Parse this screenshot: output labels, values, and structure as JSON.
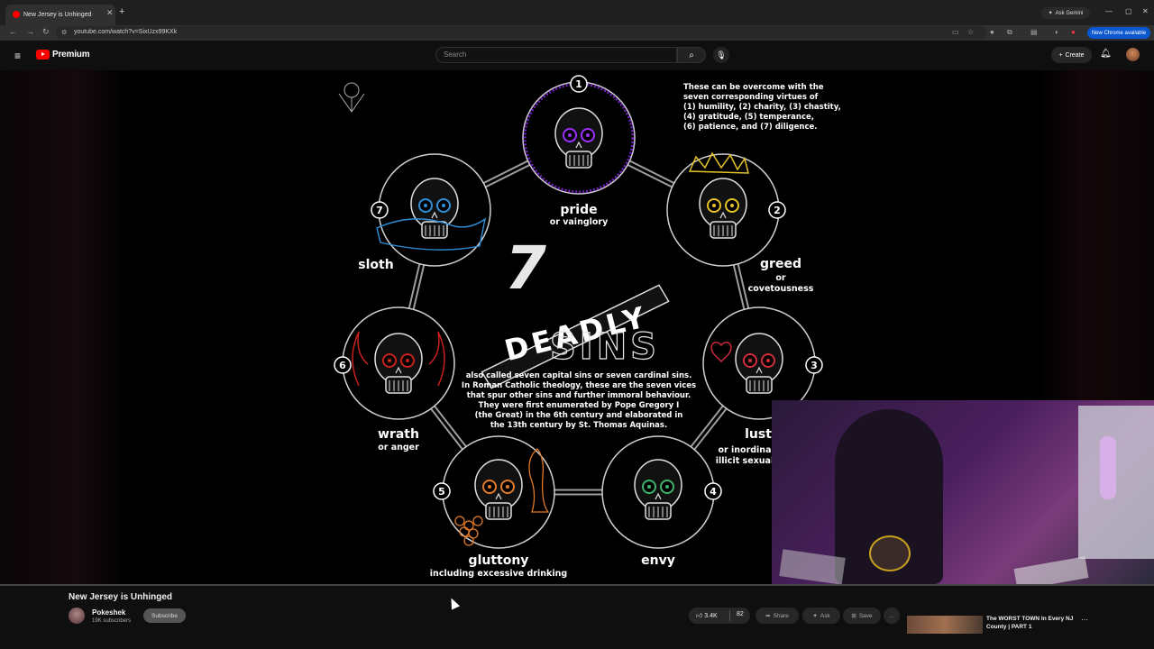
{
  "browser": {
    "tab_title": "New Jersey is Unhinged - YouTube",
    "new_tab_symbol": "+",
    "ask_gemini": "Ask Gemini",
    "url": "youtube.com/watch?v=SixUzx99KXk",
    "new_chrome": "New Chrome available"
  },
  "youtube": {
    "logo_text": "Premium",
    "search_placeholder": "Search",
    "create_label": "Create"
  },
  "video_art": {
    "number_seven": "7",
    "title_word_1": "DEADLY",
    "title_word_2": "SINS",
    "virtues": [
      "These can be overcome with the",
      "seven corresponding virtues of",
      "(1) humility, (2) charity, (3) chastity,",
      "(4) gratitude, (5) temperance,",
      "(6) patience, and (7) diligence."
    ],
    "description": [
      "also called seven capital sins or seven cardinal sins.",
      "In Roman Catholic theology, these are the seven vices",
      "that spur other sins and further immoral behaviour.",
      "They were first enumerated by Pope Gregory I",
      "(the Great) in the 6th century and elaborated in",
      "the 13th century by St. Thomas Aquinas."
    ],
    "sins": [
      {
        "num": "1",
        "name": "pride",
        "sub": "or vainglory",
        "color": "#9b30ff"
      },
      {
        "num": "2",
        "name": "greed",
        "sub1": "or",
        "sub2": "covetousness",
        "color": "#e6c229"
      },
      {
        "num": "3",
        "name": "lust",
        "sub1": "or inordina",
        "sub2": "illicit sexual",
        "color": "#d22c3c"
      },
      {
        "num": "4",
        "name": "envy",
        "sub": "",
        "color": "#3cb46e"
      },
      {
        "num": "5",
        "name": "gluttony",
        "sub": "including excessive drinking",
        "color": "#e07a2a"
      },
      {
        "num": "6",
        "name": "wrath",
        "sub": "or anger",
        "color": "#c8201e"
      },
      {
        "num": "7",
        "name": "sloth",
        "sub": "",
        "color": "#2e8fd8"
      }
    ]
  },
  "video": {
    "title": "New Jersey is Unhinged",
    "channel": "Pokeshek",
    "subscribers": "19K subscribers",
    "subscribe_label": "Subscribe",
    "likes": "3.4K",
    "dislike_count": "82",
    "share_label": "Share",
    "ask_label": "Ask",
    "save_label": "Save"
  },
  "recommendation": {
    "title": "The WORST TOWN In Every NJ County | PART 1"
  }
}
